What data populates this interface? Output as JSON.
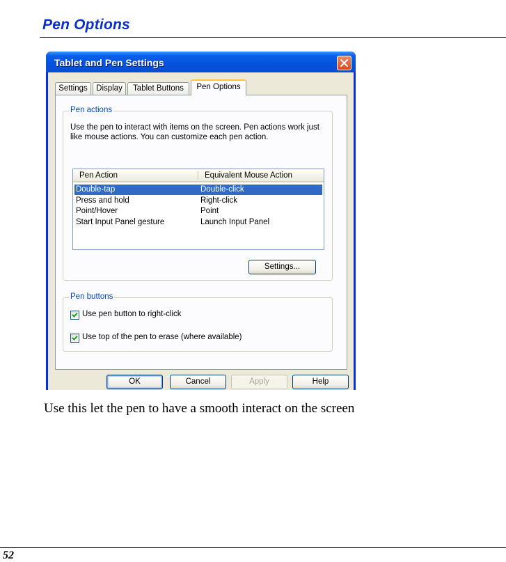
{
  "document": {
    "heading": "Pen Options",
    "caption": "Use this let the pen to have a smooth interact on the screen",
    "page_number": "52",
    "heading_color": "#0a2fc8"
  },
  "dialog": {
    "title": "Tablet and Pen Settings",
    "tabs": [
      {
        "label": "Settings",
        "active": false
      },
      {
        "label": "Display",
        "active": false
      },
      {
        "label": "Tablet Buttons",
        "active": false
      },
      {
        "label": "Pen Options",
        "active": true
      }
    ],
    "pen_actions": {
      "legend": "Pen actions",
      "description": "Use the pen to interact with items on the screen. Pen actions work just like mouse actions. You can customize each pen action.",
      "columns": [
        "Pen Action",
        "Equivalent Mouse Action"
      ],
      "rows": [
        {
          "action": "Double-tap",
          "mouse": "Double-click",
          "selected": true
        },
        {
          "action": "Press and hold",
          "mouse": "Right-click",
          "selected": false
        },
        {
          "action": "Point/Hover",
          "mouse": "Point",
          "selected": false
        },
        {
          "action": "Start Input Panel gesture",
          "mouse": "Launch Input Panel",
          "selected": false
        }
      ],
      "settings_button": "Settings..."
    },
    "pen_buttons": {
      "legend": "Pen buttons",
      "options": [
        {
          "label": "Use pen button to right-click",
          "checked": true
        },
        {
          "label": "Use top of the pen to erase (where available)",
          "checked": true
        }
      ]
    },
    "buttons": {
      "ok": "OK",
      "cancel": "Cancel",
      "apply": "Apply",
      "help": "Help"
    },
    "colors": {
      "title_bar": "#0553dd",
      "selection": "#316ac5",
      "group_legend": "#0046d5",
      "face": "#ece9d8"
    }
  }
}
